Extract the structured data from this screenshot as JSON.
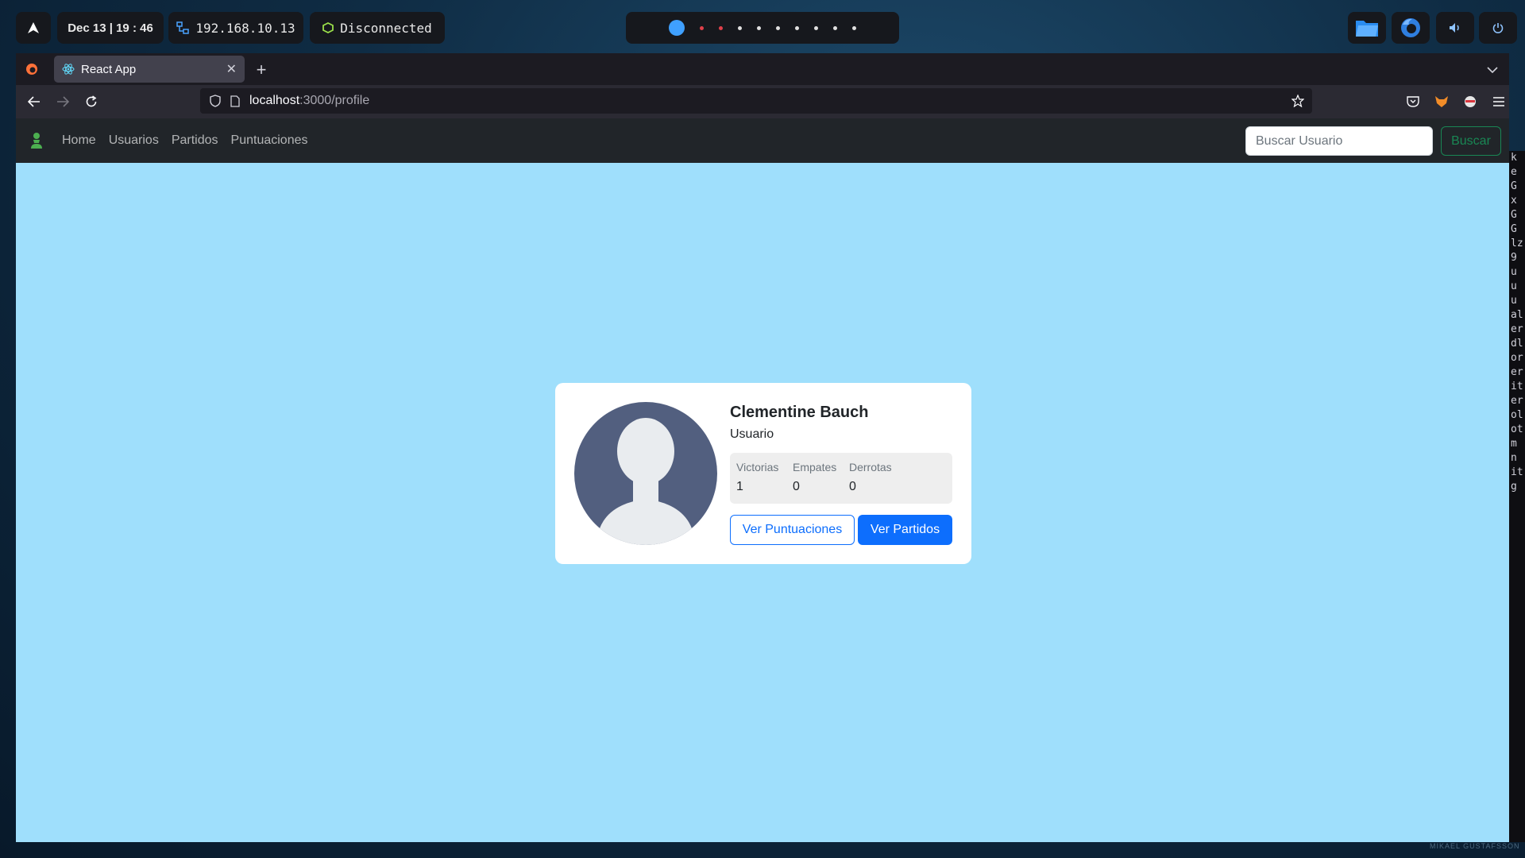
{
  "desktop": {
    "datetime": "Dec 13 | 19 : 46",
    "ip": "192.168.10.13",
    "vpn_status": "Disconnected",
    "workspace_count": 10,
    "active_workspace": 1
  },
  "browser": {
    "tab_title": "React App",
    "url_host": "localhost",
    "url_path": ":3000/profile"
  },
  "app": {
    "nav_links": [
      "Home",
      "Usuarios",
      "Partidos",
      "Puntuaciones"
    ],
    "search_placeholder": "Buscar Usuario",
    "search_button": "Buscar",
    "profile": {
      "name": "Clementine Bauch",
      "role": "Usuario",
      "stats": [
        {
          "label": "Victorias",
          "value": "1"
        },
        {
          "label": "Empates",
          "value": "0"
        },
        {
          "label": "Derrotas",
          "value": "0"
        }
      ],
      "btn_scores": "Ver Puntuaciones",
      "btn_matches": "Ver Partidos"
    },
    "colors": {
      "page_bg": "#9fdffc",
      "nav_bg": "#212529",
      "primary": "#0d6efd",
      "success": "#198754",
      "avatar_bg": "#525f7f"
    }
  },
  "edge_text": [
    "k",
    "e",
    "G",
    "x",
    "G",
    "G",
    "lz",
    "9",
    "u",
    "u",
    "u",
    "al",
    "er",
    "dl",
    "or",
    "er",
    "it",
    "er",
    "ol",
    "ot",
    "m",
    "n",
    "it",
    "g"
  ],
  "watermark": "MIKAEL GUSTAFSSON"
}
